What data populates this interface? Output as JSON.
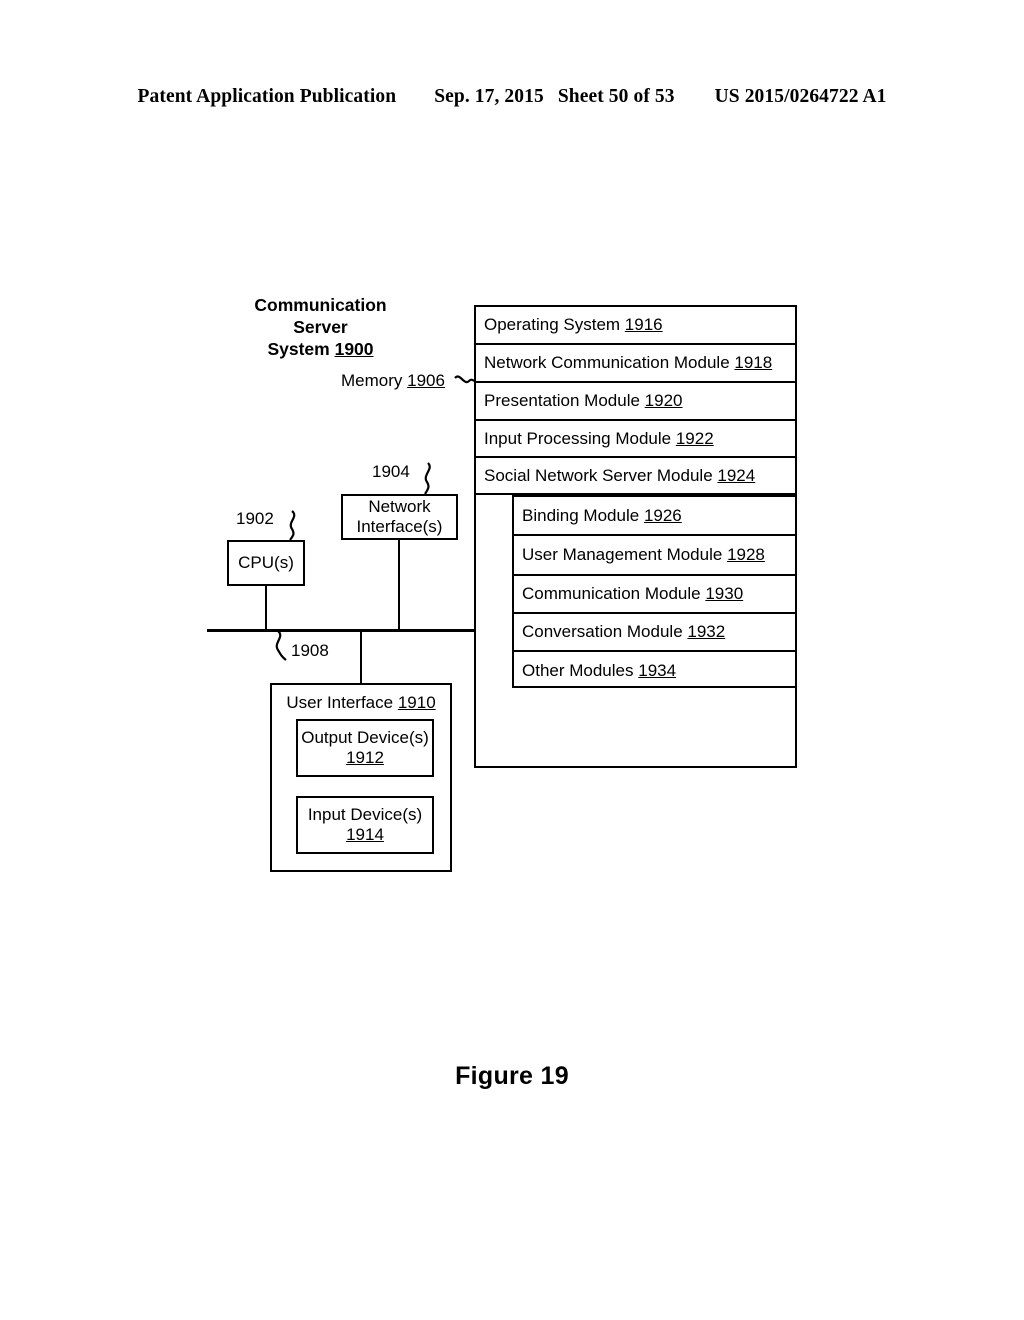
{
  "header": {
    "publication": "Patent Application Publication",
    "date": "Sep. 17, 2015",
    "sheet": "Sheet 50 of 53",
    "patent_number": "US 2015/0264722 A1"
  },
  "figure": {
    "caption": "Figure 19",
    "system_title_line1": "Communication Server",
    "system_title_line2": "System",
    "system_ref": "1900",
    "memory_label": "Memory",
    "memory_ref": "1906",
    "bus_ref": "1908",
    "cpu": {
      "label": "CPU(s)",
      "ref": "1902"
    },
    "network_interface": {
      "line1": "Network",
      "line2": "Interface(s)",
      "ref": "1904"
    },
    "user_interface": {
      "label": "User Interface",
      "ref": "1910",
      "output_device": {
        "line1": "Output Device(s)",
        "ref": "1912"
      },
      "input_device": {
        "line1": "Input Device(s)",
        "ref": "1914"
      }
    },
    "memory_modules": [
      {
        "label": "Operating System",
        "ref": "1916"
      },
      {
        "label": "Network Communication Module",
        "ref": "1918"
      },
      {
        "label": "Presentation Module",
        "ref": "1920"
      },
      {
        "label": "Input Processing Module",
        "ref": "1922"
      },
      {
        "label": "Social Network Server Module",
        "ref": "1924"
      }
    ],
    "submodules": [
      {
        "label": "Binding Module",
        "ref": "1926"
      },
      {
        "label": "User Management Module",
        "ref": "1928"
      },
      {
        "label": "Communication Module",
        "ref": "1930"
      },
      {
        "label": "Conversation Module",
        "ref": "1932"
      },
      {
        "label": "Other Modules",
        "ref": "1934"
      }
    ]
  }
}
